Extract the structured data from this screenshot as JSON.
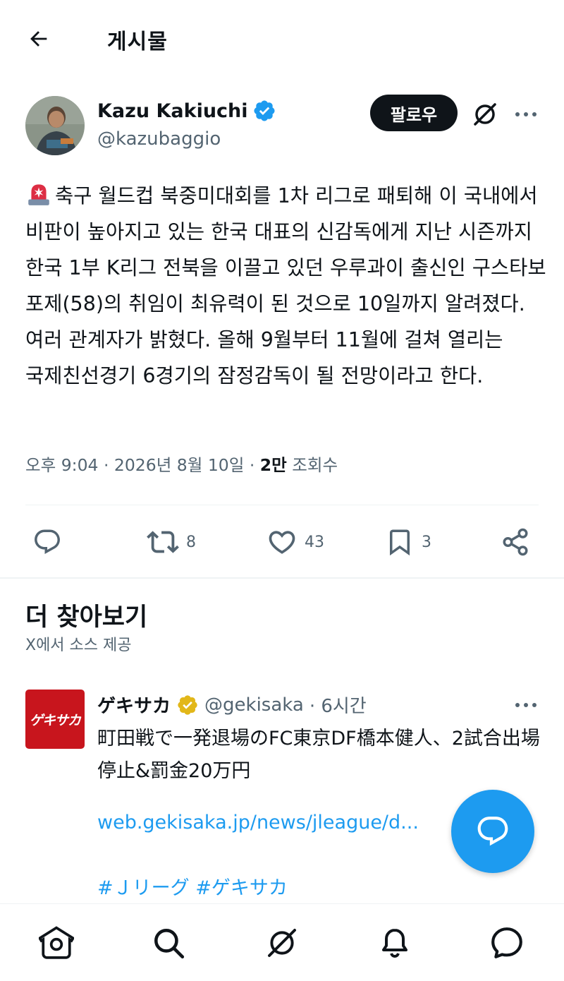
{
  "header": {
    "title": "게시물",
    "back_icon": "arrow-left-icon"
  },
  "author": {
    "name": "Kazu Kakiuchi",
    "handle": "@kazubaggio",
    "verified_color": "#1d9bf0",
    "follow_label": "팔로우"
  },
  "post": {
    "text": "축구 월드컵 북중미대회를 1차 리그로 패퇴해 이 국내에서 비판이 높아지고 있는 한국 대표의 신감독에게 지난 시즌까지 한국 1부 K리그 전북을 이끌고 있던 우루과이 출신인 구스타보 포제(58)의 취임이 최유력이 된 것으로 10일까지 알려졌다. 여러 관계자가 밝혔다. 올해 9월부터 11월에 걸쳐 열리는 국제친선경기 6경기의 잠정감독이 될 전망이라고 한다.",
    "time": "오후 9:04",
    "date": "2026년 8월 10일",
    "views_count": "2만",
    "views_label": "조회수"
  },
  "actions": {
    "reply_count": "",
    "repost_count": "8",
    "like_count": "43",
    "bookmark_count": "3"
  },
  "discover": {
    "title": "더 찾아보기",
    "subtitle": "X에서 소스 제공"
  },
  "related": {
    "avatar_text": "ゲキサカ",
    "name": "ゲキサカ",
    "handle": "@gekisaka",
    "time": "· 6시간",
    "badge_color": "#e2b719",
    "text": "町田戦で一発退場のFC東京DF橋本健人、2試合出場停止&罰金20万円",
    "link": "web.gekisaka.jp/news/jleague/d...",
    "tags": "#Ｊリーグ #ゲキサカ"
  },
  "colors": {
    "accent": "#1d9bf0",
    "text": "#0f1419",
    "secondary": "#536471"
  }
}
